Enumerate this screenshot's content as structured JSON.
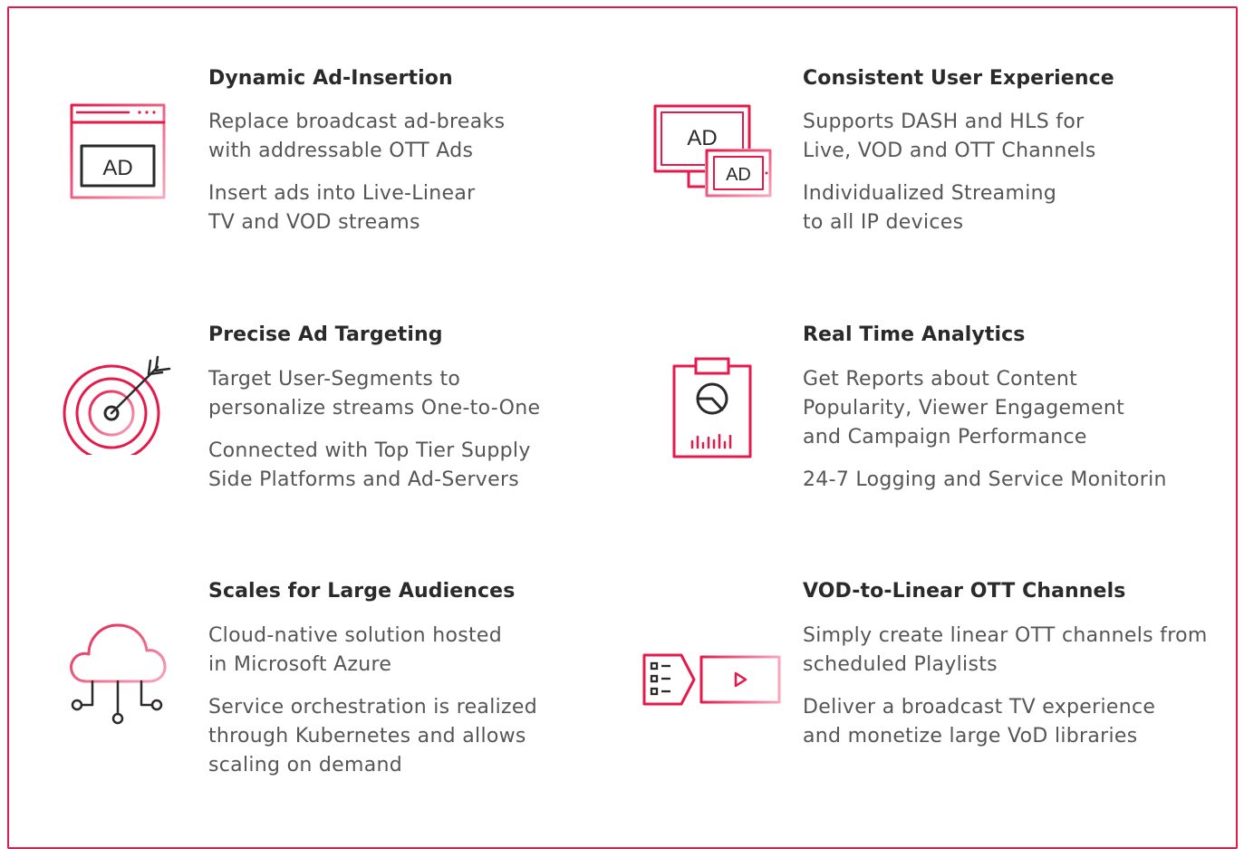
{
  "colors": {
    "accent": "#e5194a",
    "icon_light": "#f7a6bd",
    "title": "#2a2a2a",
    "body": "#555555"
  },
  "features": [
    {
      "icon": "ad-browser-icon",
      "title": "Dynamic Ad-Insertion",
      "icon_text": "AD",
      "paragraphs": [
        [
          "Replace broadcast ad-breaks",
          "with addressable OTT Ads"
        ],
        [
          "Insert ads into Live-Linear",
          "TV and VOD streams"
        ]
      ]
    },
    {
      "icon": "ad-multiscreen-icon",
      "title": "Consistent User Experience",
      "icon_text": "AD",
      "paragraphs": [
        [
          "Supports DASH and HLS for",
          "Live, VOD and OTT Channels"
        ],
        [
          "Individualized Streaming",
          "to all IP devices"
        ]
      ]
    },
    {
      "icon": "target-icon",
      "title": "Precise Ad Targeting",
      "paragraphs": [
        [
          "Target User-Segments to",
          "personalize streams One-to-One"
        ],
        [
          "Connected with Top Tier Supply",
          "Side Platforms and Ad-Servers"
        ]
      ]
    },
    {
      "icon": "analytics-clipboard-icon",
      "title": "Real Time Analytics",
      "paragraphs": [
        [
          "Get Reports about Content",
          "Popularity, Viewer Engagement",
          "and Campaign Performance"
        ],
        [
          "24-7 Logging and Service Monitorin"
        ]
      ]
    },
    {
      "icon": "cloud-network-icon",
      "title": "Scales for Large Audiences",
      "paragraphs": [
        [
          "Cloud-native solution hosted",
          "in Microsoft Azure"
        ],
        [
          "Service orchestration is realized",
          "through Kubernetes and allows",
          "scaling on demand"
        ]
      ]
    },
    {
      "icon": "playlist-to-player-icon",
      "title": "VOD-to-Linear OTT Channels",
      "paragraphs": [
        [
          "Simply create linear OTT channels from",
          "scheduled Playlists"
        ],
        [
          "Deliver a broadcast TV experience",
          "and monetize large VoD libraries"
        ]
      ]
    }
  ]
}
